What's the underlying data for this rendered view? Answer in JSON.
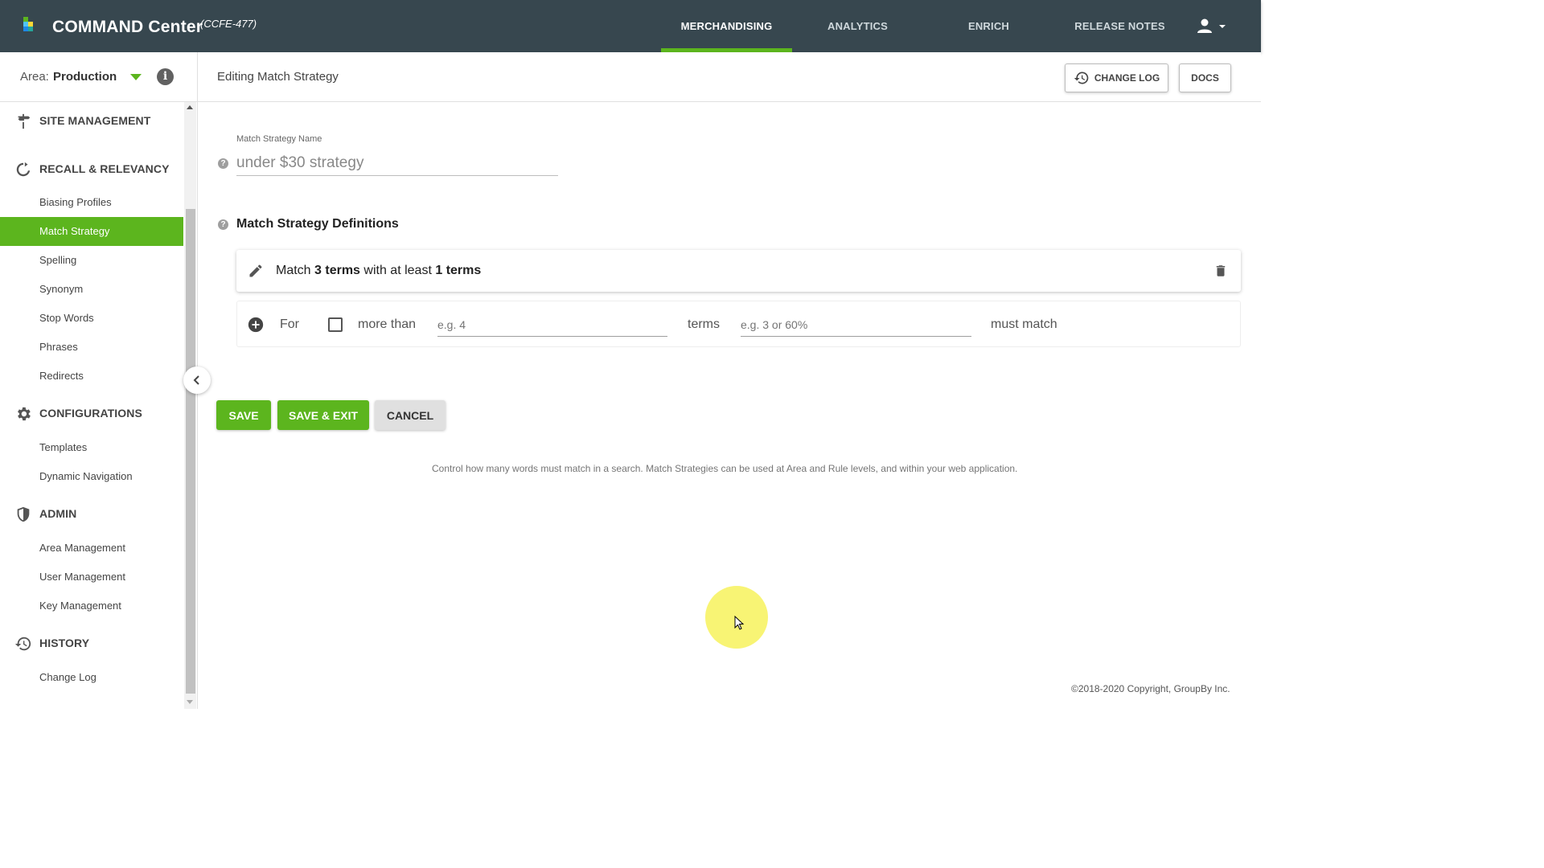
{
  "app": {
    "brand": "COMMAND Center",
    "tag": "(CCFE-477)",
    "colors": {
      "accent": "#5cb51e",
      "topbar": "#37474f"
    }
  },
  "nav": {
    "tabs": [
      {
        "label": "MERCHANDISING",
        "active": true
      },
      {
        "label": "ANALYTICS",
        "active": false
      },
      {
        "label": "ENRICH",
        "active": false
      },
      {
        "label": "RELEASE NOTES",
        "active": false
      }
    ],
    "user_icon": "account-icon"
  },
  "area": {
    "label": "Area:",
    "value": "Production"
  },
  "header": {
    "title": "Editing Match Strategy",
    "changelog_label": "CHANGE LOG",
    "docs_label": "DOCS"
  },
  "sidebar": {
    "sections": [
      {
        "title": "SITE MANAGEMENT",
        "icon": "signpost-icon",
        "items": []
      },
      {
        "title": "RECALL & RELEVANCY",
        "icon": "refresh-circle-icon",
        "items": [
          "Biasing Profiles",
          "Match Strategy",
          "Spelling",
          "Synonym",
          "Stop Words",
          "Phrases",
          "Redirects"
        ]
      },
      {
        "title": "CONFIGURATIONS",
        "icon": "gear-icon",
        "items": [
          "Templates",
          "Dynamic Navigation"
        ]
      },
      {
        "title": "ADMIN",
        "icon": "shield-icon",
        "items": [
          "Area Management",
          "User Management",
          "Key Management"
        ]
      },
      {
        "title": "HISTORY",
        "icon": "history-icon",
        "items": [
          "Change Log"
        ]
      }
    ],
    "active_item": "Match Strategy"
  },
  "form": {
    "name_label": "Match Strategy Name",
    "name_value": "under $30 strategy",
    "definitions_title": "Match Strategy Definitions",
    "definition": {
      "prefix": "Match",
      "terms_count": "3 terms",
      "middle": "with at least",
      "min_terms": "1 terms"
    },
    "new_row": {
      "for_label": "For",
      "more_than_label": "more than",
      "terms_placeholder": "e.g. 4",
      "terms_label": "terms",
      "match_placeholder": "e.g. 3 or 60%",
      "must_match_label": "must match"
    },
    "save_label": "SAVE",
    "save_exit_label": "SAVE & EXIT",
    "cancel_label": "CANCEL",
    "help_text": "Control how many words must match in a search. Match Strategies can be used at Area and Rule levels, and within your web application."
  },
  "footer": {
    "copyright": "©2018-2020 Copyright, GroupBy Inc."
  }
}
